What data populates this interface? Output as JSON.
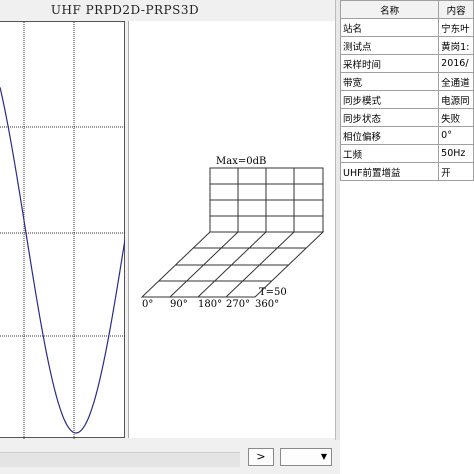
{
  "header": {
    "title": "UHF PRPD2D-PRPS3D"
  },
  "prps": {
    "max_label": "Max=0dB",
    "t_label": "T=50",
    "phase_labels": [
      "0°",
      "90°",
      "180°",
      "270°",
      "360°"
    ]
  },
  "table": {
    "headers": [
      "名称",
      "内容"
    ],
    "rows": [
      {
        "name": "站名",
        "value": "宁东叶"
      },
      {
        "name": "测试点",
        "value": "黄岗1:"
      },
      {
        "name": "采样时间",
        "value": "2016/"
      },
      {
        "name": "带宽",
        "value": "全通道"
      },
      {
        "name": "同步模式",
        "value": "电源同"
      },
      {
        "name": "同步状态",
        "value": "失败"
      },
      {
        "name": "相位偏移",
        "value": "0°"
      },
      {
        "name": "工频",
        "value": "50Hz"
      },
      {
        "name": "UHF前置增益",
        "value": "开"
      }
    ]
  },
  "controls": {
    "next_label": ">"
  },
  "colors": {
    "sine_curve": "#2b2b8a",
    "grid": "#333333"
  }
}
